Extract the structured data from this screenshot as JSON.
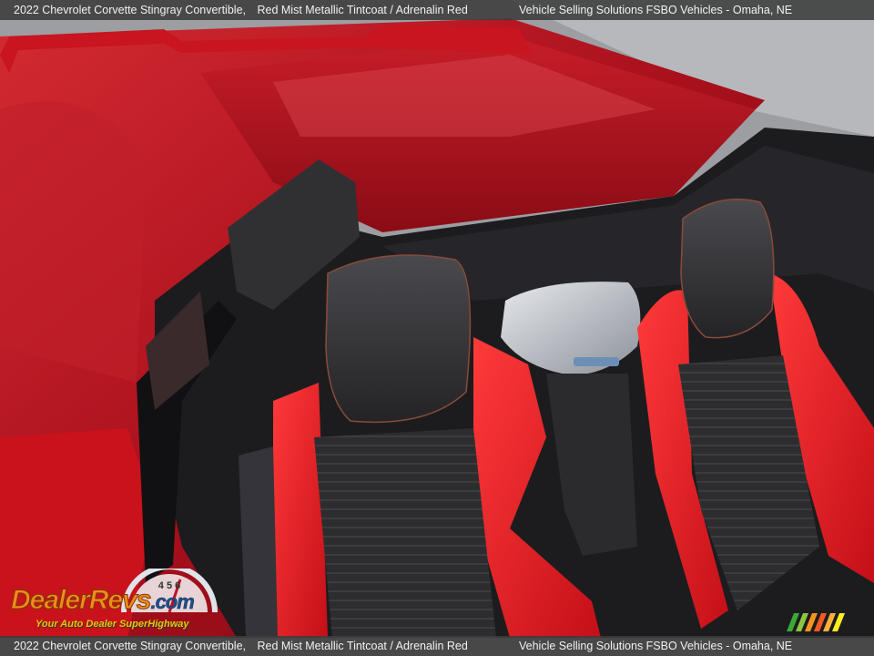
{
  "caption": {
    "vehicle": "2022 Chevrolet Corvette Stingray Convertible,",
    "color": "Red Mist Metallic Tintcoat / Adrenalin Red",
    "dealer": "Vehicle Selling Solutions FSBO Vehicles - Omaha, NE"
  },
  "watermark": {
    "brand_part1": "Dealer",
    "brand_part2": "Revs",
    "brand_part3": ".com",
    "tagline": "Your Auto Dealer SuperHighway",
    "gauge_numbers": "4 5 6"
  },
  "colors": {
    "paint": "#b3121f",
    "seat_accent": "#e0141c",
    "seat_dark": "#2a2a2c",
    "caption_bg": "#3c3c3c",
    "watermark_orange": "#f28b1e",
    "watermark_blue": "#1f4f8a"
  },
  "image": {
    "subject": "car-interior-seats-icon"
  }
}
